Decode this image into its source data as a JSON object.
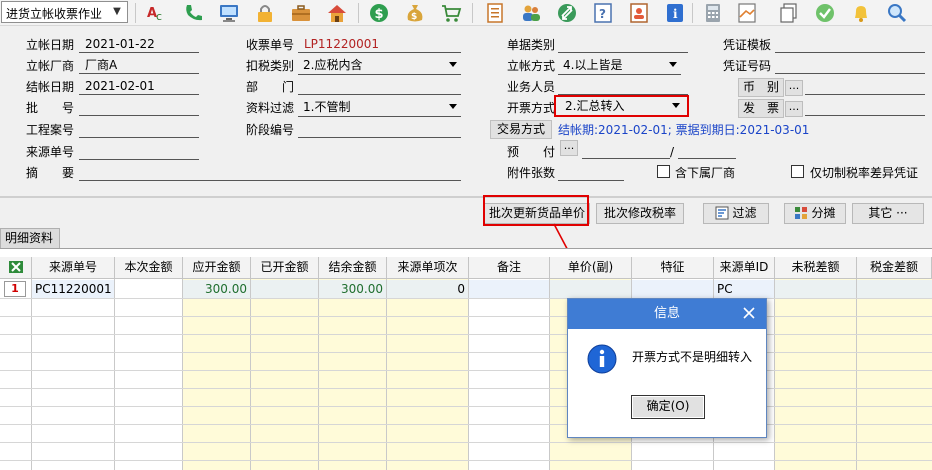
{
  "toolbar": {
    "mode_select": "进货立帐收票作业",
    "icons": [
      "spell-check-icon",
      "phone-icon",
      "computer-icon",
      "lock-icon",
      "briefcase-icon",
      "home-icon",
      "dollar-icon",
      "money-bag-icon",
      "cart-icon",
      "list-icon",
      "users-icon",
      "swap-icon",
      "help-icon",
      "contacts-icon",
      "info-icon",
      "calculator-icon",
      "folder-icon",
      "copy-icon",
      "check-icon",
      "bell-icon",
      "search-icon"
    ]
  },
  "form": {
    "post_date_label": "立帐日期",
    "post_date": "2021-01-22",
    "vendor_label": "立帐厂商",
    "vendor": "厂商A",
    "settle_date_label": "结帐日期",
    "settle_date": "2021-02-01",
    "batch_label": "批　　号",
    "batch": "",
    "project_label": "工程案号",
    "project": "",
    "source_no_label": "来源单号",
    "source_no": "",
    "summary_label": "摘　　要",
    "summary": "",
    "receipt_no_label": "收票单号",
    "receipt_no": "LP11220001",
    "tax_type_label": "扣税类别",
    "tax_type": "2.应税内含",
    "dept_label": "部　　门",
    "dept": "",
    "filter_label": "资料过滤",
    "filter": "1.不管制",
    "stage_label": "阶段编号",
    "stage": "",
    "doc_type_label": "单据类别",
    "doc_type": "",
    "post_method_label": "立帐方式",
    "post_method": "4.以上皆是",
    "staff_label": "业务人员",
    "staff": "",
    "invoice_method_label": "开票方式",
    "invoice_method": "2.汇总转入",
    "trade_method_btn": "交易方式",
    "trade_method_info": "结帐期:2021-02-01; 票据到期日:2021-03-01",
    "prepay_label": "预　　付",
    "prepay_sep": "/",
    "attach_label": "附件张数",
    "sub_vendor_label": "含下属厂商",
    "only_diff_label": "仅切制税率差异凭证",
    "voucher_tpl_label": "凭证模板",
    "voucher_no_label": "凭证号码",
    "currency_btn": "币　别",
    "invoice_btn": "发　票",
    "dots": "..."
  },
  "actions": {
    "batch_price": "批次更新货品单价",
    "batch_tax": "批次修改税率",
    "filter": "过滤",
    "split": "分摊",
    "other": "其它 ···"
  },
  "tab": "明细资料",
  "grid": {
    "headers": [
      "来源单号",
      "本次金额",
      "应开金额",
      "已开金额",
      "结余金额",
      "来源单项次",
      "备注",
      "单价(副)",
      "特征",
      "来源单ID",
      "未税差额",
      "税金差额"
    ],
    "row": {
      "num": "1",
      "source_no": "PC11220001",
      "due_amount": "300.00",
      "balance": "300.00",
      "item_no": "0",
      "source_id": "PC"
    }
  },
  "dialog": {
    "title": "信息",
    "message": "开票方式不是明细转入",
    "ok": "确定(O)"
  }
}
